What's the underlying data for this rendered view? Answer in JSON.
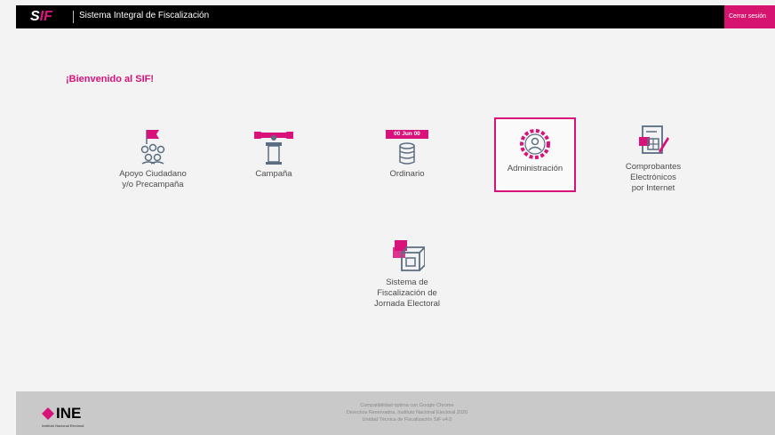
{
  "header": {
    "logo_s": "S",
    "logo_if": "IF",
    "title": "Sistema Integral de Fiscalización",
    "logout_label": "Cerrar sesión"
  },
  "welcome": "¡Bienvenido al SIF!",
  "modules": {
    "apoyo": {
      "label_line1": "Apoyo Ciudadano",
      "label_line2": "y/o Precampaña"
    },
    "campana": {
      "label": "Campaña"
    },
    "ordinario": {
      "label": "Ordinario",
      "banner": "00 Jun 00"
    },
    "administracion": {
      "label": "Administración"
    },
    "comprobantes": {
      "label_line1": "Comprobantes",
      "label_line2": "Electrónicos",
      "label_line3": "por Internet"
    },
    "jornada": {
      "label_line1": "Sistema de",
      "label_line2": "Fiscalización de",
      "label_line3": "Jornada Electoral"
    }
  },
  "footer": {
    "brand": "INE",
    "brand_sub": "Instituto Nacional Electoral",
    "info_line1": "Compatibilidad óptima con Google Chrome",
    "info_line2": "Derechos Reservados, Instituto Nacional Electoral 2020",
    "info_line3": "Unidad Técnica de Fiscalización SIF v4.0"
  },
  "colors": {
    "accent": "#d8127a",
    "header": "#000000",
    "footer": "#c9c9c9",
    "icon_gray": "#5b6d82"
  }
}
